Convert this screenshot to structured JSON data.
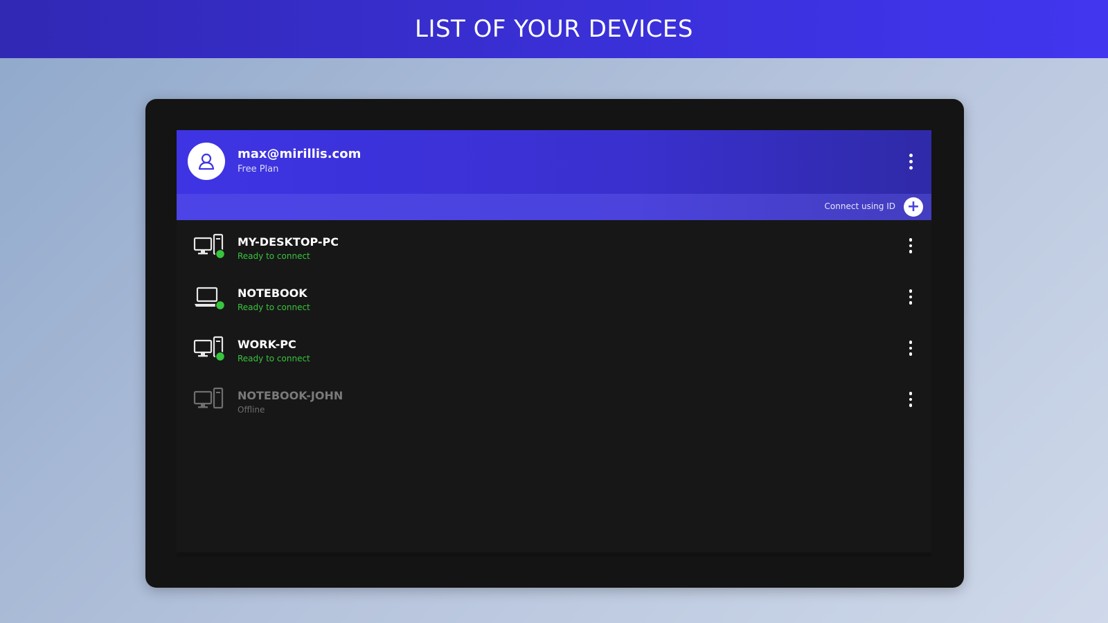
{
  "banner": {
    "title": "LIST OF YOUR DEVICES"
  },
  "account": {
    "email": "max@mirillis.com",
    "plan": "Free Plan",
    "avatar_icon": "user-icon",
    "menu_icon": "more-vertical-icon"
  },
  "connect": {
    "label": "Connect using ID",
    "button_icon": "plus-icon",
    "button_glyph": "+"
  },
  "devices": [
    {
      "name": "MY-DESKTOP-PC",
      "status": "Ready to connect",
      "type": "desktop",
      "online": true
    },
    {
      "name": "NOTEBOOK",
      "status": "Ready to connect",
      "type": "laptop",
      "online": true
    },
    {
      "name": "WORK-PC",
      "status": "Ready to connect",
      "type": "desktop",
      "online": true
    },
    {
      "name": "NOTEBOOK-JOHN",
      "status": "Offline",
      "type": "desktop",
      "online": false
    }
  ],
  "colors": {
    "accent": "#3a30d8",
    "online": "#38c43e",
    "panel": "#171717"
  }
}
